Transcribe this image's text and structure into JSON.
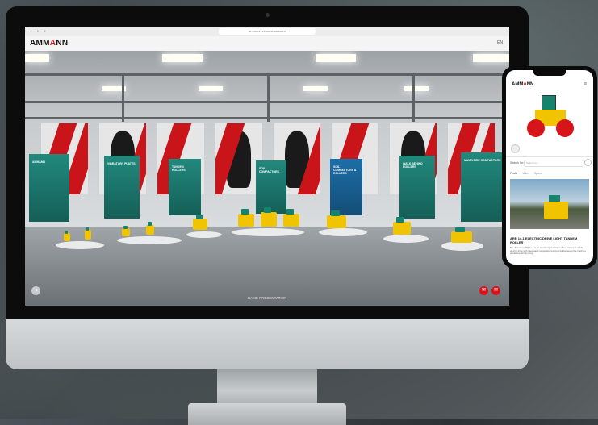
{
  "browser": {
    "url": "ammann.virtualshowroom"
  },
  "app": {
    "brand_prefix": "AMM",
    "brand_accent": "A",
    "brand_suffix": "NN",
    "header_right": "EN"
  },
  "showroom": {
    "panels": [
      {
        "label": "AMMANN"
      },
      {
        "label": "VIBRATORY PLATES"
      },
      {
        "label": "TANDEM ROLLERS"
      },
      {
        "label": "SOIL COMPACTORS"
      },
      {
        "label": "SOIL COMPACTORS & ROLLERS"
      },
      {
        "label": "WALK BEHIND ROLLERS"
      },
      {
        "label": "MULTI-TIRE COMPACTORS"
      }
    ],
    "caption": "GAME PRESENTATION"
  },
  "phone": {
    "brand_prefix": "AMM",
    "brand_accent": "A",
    "brand_suffix": "NN",
    "search_label": "Search for:",
    "search_placeholder": "Search for ...",
    "tabs": [
      "Photo",
      "Video",
      "Specs"
    ],
    "product_title": "ARR 1x-1 ELECTRIC DRIVE LIGHT TANDEM ROLLER",
    "product_desc": "The Ammann ARR 1x-1 is an electric light tandem roller. It features a fully electric drive with integrated compaction technology that keeps the machine productive all day long."
  },
  "colors": {
    "brand_red": "#d7141a",
    "ammann_green": "#16836f",
    "ammann_yellow": "#f0c400"
  },
  "icons": {
    "left_button": "arrow-icon",
    "right_buttons": [
      "chat-icon",
      "share-icon"
    ]
  }
}
